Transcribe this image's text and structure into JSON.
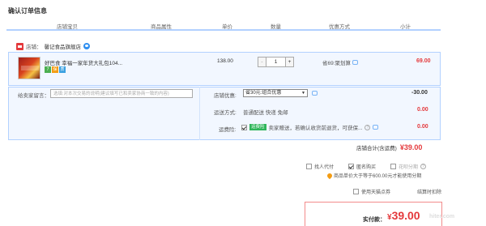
{
  "page": {
    "title": "确认订单信息"
  },
  "columns": [
    "店铺宝贝",
    "商品属性",
    "单价",
    "数量",
    "优惠方式",
    "小计"
  ],
  "shop": {
    "label": "店铺：",
    "name": "馨记食品旗舰店"
  },
  "item": {
    "name": "好巴食 幸福一家年货大礼包104...",
    "badges": [
      "7",
      "保",
      "质"
    ],
    "price": "138.00",
    "quantity": "1",
    "qty_minus": "-",
    "qty_plus": "+",
    "discount": "省69:聚划算",
    "subtotal": "69.00"
  },
  "message": {
    "label": "给卖家留言：",
    "placeholder": "选填:对本次交易的说明(建议填写已和卖家协商一致的内容)"
  },
  "store_discount": {
    "label": "店铺优惠:",
    "selected": "省30元:组合优惠",
    "value": "-30.00"
  },
  "shipping": {
    "label": "运送方式:",
    "value": "普通配送 快递 免邮",
    "amount": "0.00"
  },
  "insurance": {
    "label": "运费险:",
    "tag": "运费险",
    "text": "卖家赠送，若确认收货前退货，可获保...",
    "amount": "0.00"
  },
  "shop_total": {
    "label": "店铺合计(含运费)",
    "amount": "¥39.00"
  },
  "options": {
    "proxy": "找人代付",
    "anonymous": "匿名购买",
    "huabei": "花呗分期",
    "condition": "商品单价大于等于600.00元才能使用分期",
    "tmall_card": "使用天猫点券",
    "settle_link": "结算时扣除"
  },
  "payment": {
    "label": "实付款：",
    "currency": "¥",
    "amount": "39.00"
  },
  "watermark": "hiter.com"
}
